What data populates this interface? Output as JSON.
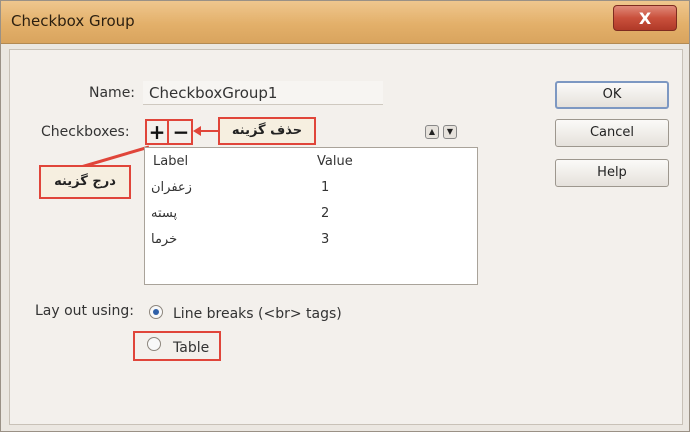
{
  "window": {
    "title": "Checkbox Group",
    "close_label": "X"
  },
  "form": {
    "name_label": "Name:",
    "name_value": "CheckboxGroup1",
    "checkboxes_label": "Checkboxes:",
    "add_symbol": "+",
    "remove_symbol": "−",
    "annotation_add": "درج گزینه",
    "annotation_remove": "حذف گزینه",
    "move_up_symbol": "▲",
    "move_down_symbol": "▼"
  },
  "grid": {
    "columns": [
      "Label",
      "Value"
    ],
    "rows": [
      {
        "label": "زعفران",
        "value": "1"
      },
      {
        "label": "پسته",
        "value": "2"
      },
      {
        "label": "خرما",
        "value": "3"
      }
    ]
  },
  "layout": {
    "label": "Lay out using:",
    "options": [
      {
        "label": "Line breaks (<br> tags)",
        "selected": true
      },
      {
        "label": "Table",
        "selected": false
      }
    ]
  },
  "buttons": {
    "ok": "OK",
    "cancel": "Cancel",
    "help": "Help"
  },
  "colors": {
    "titlebar": "#e3b06a",
    "annotation_border": "#e0453a",
    "close_button": "#c9503c"
  }
}
